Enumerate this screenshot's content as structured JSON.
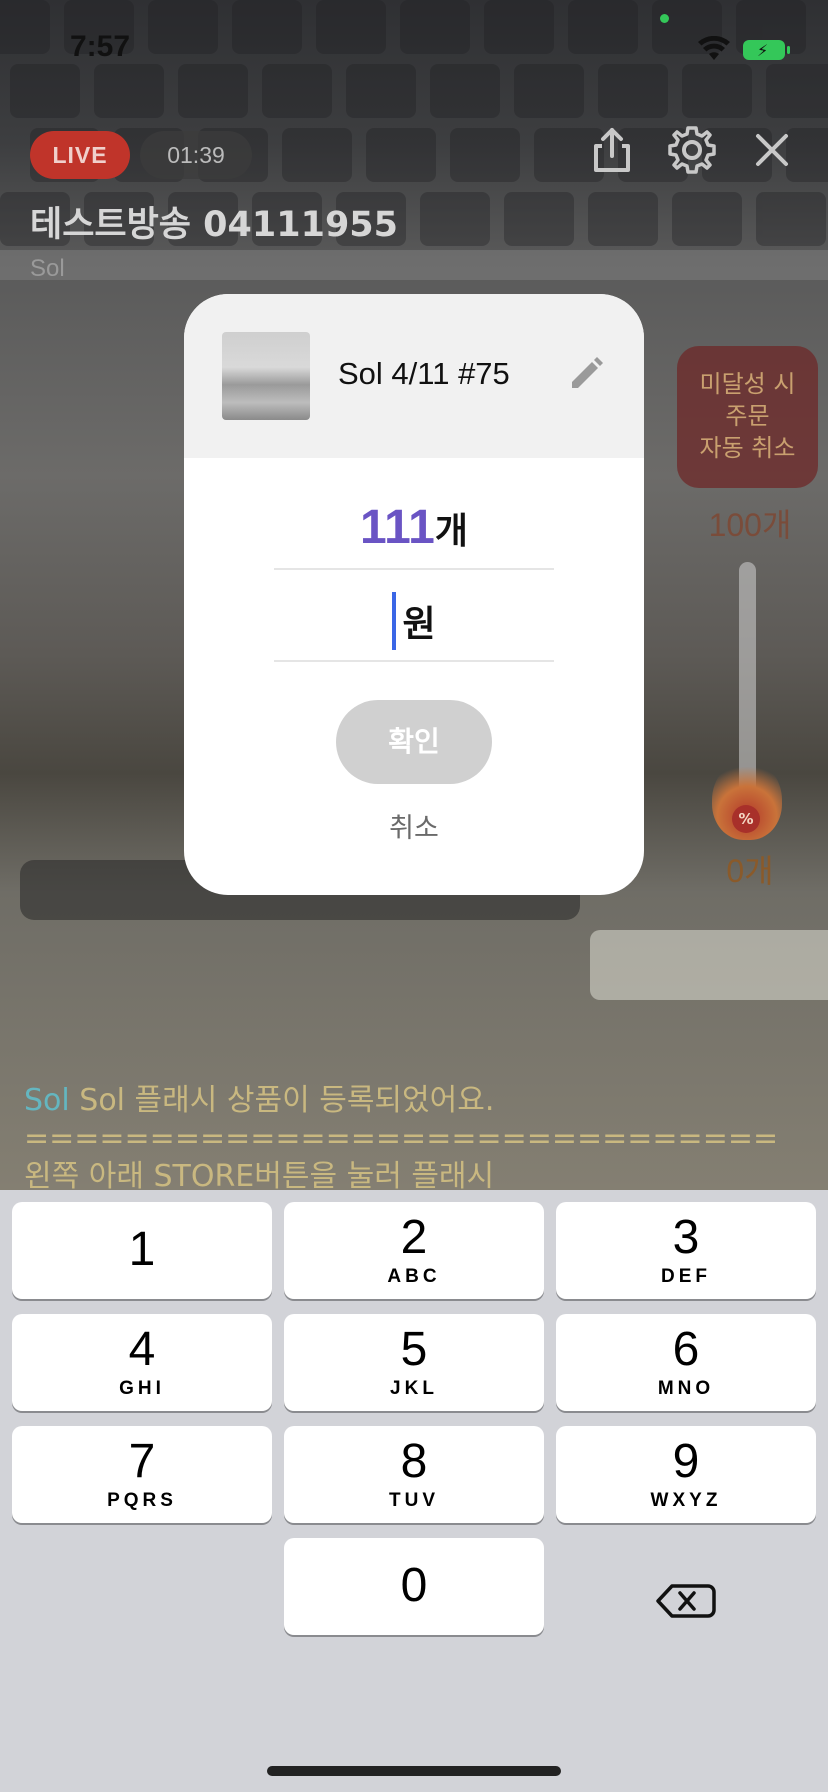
{
  "status_bar": {
    "time": "7:57"
  },
  "stream": {
    "live_label": "LIVE",
    "elapsed": "01:39",
    "title": "테스트방송 04111955",
    "host": "Sol"
  },
  "flash_widget": {
    "auto_cancel_text": "미달성 시\n주문\n자동 취소",
    "goal_count": "100개",
    "current_count": "0개",
    "badge": "%",
    "progress_fraction": 0.0
  },
  "chat": {
    "sender": "Sol",
    "message": "Sol 플래시 상품이 등록되었어요.",
    "separator": "==============================",
    "next_line": "왼쪽 아래 STORE버튼을 눌러 플래시"
  },
  "dialog": {
    "product_name": "Sol 4/11 #75",
    "quantity_value": "111",
    "quantity_unit": "개",
    "price_value": "",
    "price_unit": "원",
    "confirm_label": "확인",
    "cancel_label": "취소"
  },
  "keypad": {
    "keys": [
      {
        "digit": "1",
        "letters": ""
      },
      {
        "digit": "2",
        "letters": "ABC"
      },
      {
        "digit": "3",
        "letters": "DEF"
      },
      {
        "digit": "4",
        "letters": "GHI"
      },
      {
        "digit": "5",
        "letters": "JKL"
      },
      {
        "digit": "6",
        "letters": "MNO"
      },
      {
        "digit": "7",
        "letters": "PQRS"
      },
      {
        "digit": "8",
        "letters": "TUV"
      },
      {
        "digit": "9",
        "letters": "WXYZ"
      },
      {
        "digit": "0",
        "letters": ""
      }
    ]
  },
  "colors": {
    "live_red": "#c0342a",
    "quantity_purple": "#6a54c4",
    "caret_blue": "#3a66e6",
    "chat_name": "#64b6c0",
    "chat_text": "#c9b880"
  }
}
